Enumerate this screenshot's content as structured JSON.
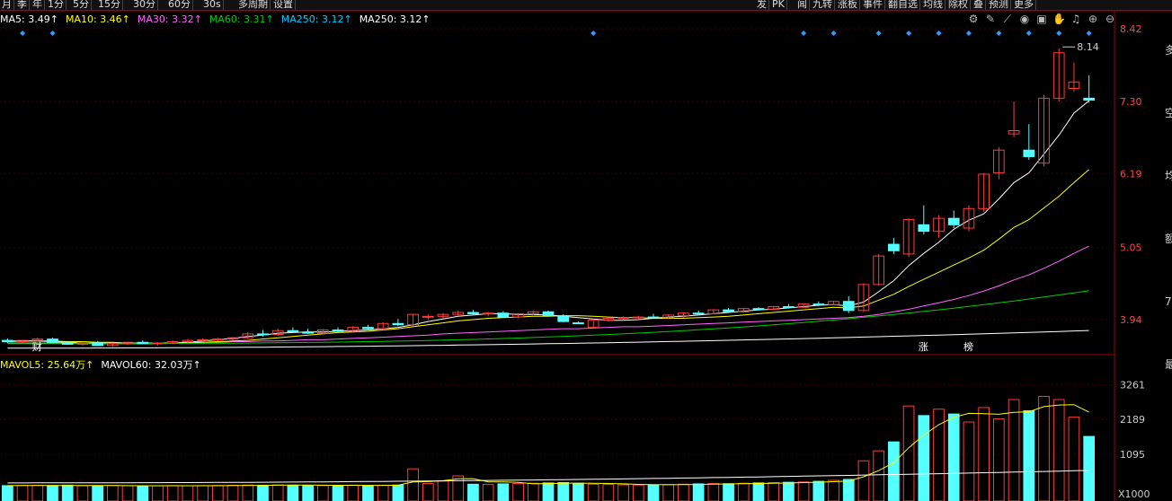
{
  "toolbar": {
    "left_buttons": [
      "月",
      "季",
      "年",
      "1分",
      "5分",
      "15分",
      "30分",
      "60分",
      "30s",
      "多周期",
      "设置"
    ],
    "right_buttons": [
      "发",
      "PK",
      "闻",
      "九转",
      "涨板",
      "事件",
      "翻自选",
      "均线",
      "除权",
      "叠",
      "预测",
      "更多"
    ]
  },
  "icons": [
    "gear-icon",
    "pen-icon",
    "ruler-icon",
    "eye-icon",
    "gift-icon",
    "hand-icon",
    "bell-icon",
    "zoom-in-icon",
    "zoom-out-icon"
  ],
  "ma_legend": [
    {
      "label": "MA5: 3.49",
      "color": "#ffffff"
    },
    {
      "label": "MA10: 3.46",
      "color": "#ffff00"
    },
    {
      "label": "MA30: 3.32",
      "color": "#ff66ff"
    },
    {
      "label": "MA60: 3.31",
      "color": "#00cc00"
    },
    {
      "label": "MA250: 3.12",
      "color": "#00ccff"
    },
    {
      "label": "MA250: 3.12",
      "color": "#ffffff"
    }
  ],
  "vol_legend": [
    {
      "label": "MAVOL5: 25.64万",
      "color": "#ffff00"
    },
    {
      "label": "MAVOL60: 32.03万",
      "color": "#ffffff"
    }
  ],
  "price_axis": [
    "8.42",
    "7.30",
    "6.19",
    "5.05",
    "3.94"
  ],
  "volume_axis": [
    "3261",
    "2189",
    "1095"
  ],
  "volume_unit": "X1000",
  "max_price_label": "8.14",
  "markers": [
    {
      "text": "财",
      "color": "#ffffff"
    },
    {
      "text": "涨",
      "color": "#ffffff"
    },
    {
      "text": "榜",
      "color": "#ffffff"
    }
  ],
  "right_edge_chars": [
    "多",
    "空",
    "均",
    "额",
    "7",
    "最"
  ],
  "chart_data": {
    "type": "candlestick",
    "price_range": [
      3.4,
      8.42
    ],
    "volume_range": [
      0,
      3500
    ],
    "candles": [
      [
        3.62,
        3.65,
        3.58,
        3.6
      ],
      [
        3.6,
        3.63,
        3.57,
        3.62
      ],
      [
        3.62,
        3.66,
        3.6,
        3.64
      ],
      [
        3.64,
        3.66,
        3.58,
        3.59
      ],
      [
        3.59,
        3.61,
        3.55,
        3.56
      ],
      [
        3.56,
        3.6,
        3.54,
        3.58
      ],
      [
        3.58,
        3.61,
        3.53,
        3.54
      ],
      [
        3.54,
        3.58,
        3.52,
        3.57
      ],
      [
        3.57,
        3.6,
        3.55,
        3.59
      ],
      [
        3.59,
        3.62,
        3.56,
        3.57
      ],
      [
        3.57,
        3.59,
        3.54,
        3.58
      ],
      [
        3.58,
        3.62,
        3.56,
        3.6
      ],
      [
        3.6,
        3.64,
        3.58,
        3.62
      ],
      [
        3.62,
        3.65,
        3.6,
        3.63
      ],
      [
        3.63,
        3.66,
        3.61,
        3.64
      ],
      [
        3.64,
        3.67,
        3.62,
        3.66
      ],
      [
        3.66,
        3.75,
        3.64,
        3.72
      ],
      [
        3.72,
        3.78,
        3.68,
        3.71
      ],
      [
        3.71,
        3.8,
        3.69,
        3.77
      ],
      [
        3.77,
        3.82,
        3.74,
        3.75
      ],
      [
        3.75,
        3.8,
        3.72,
        3.73
      ],
      [
        3.73,
        3.79,
        3.71,
        3.78
      ],
      [
        3.78,
        3.82,
        3.74,
        3.76
      ],
      [
        3.76,
        3.84,
        3.74,
        3.82
      ],
      [
        3.82,
        3.86,
        3.78,
        3.8
      ],
      [
        3.8,
        3.9,
        3.78,
        3.88
      ],
      [
        3.88,
        3.95,
        3.84,
        3.86
      ],
      [
        3.86,
        4.03,
        3.84,
        4.02
      ],
      [
        3.98,
        4.02,
        3.94,
        3.99
      ],
      [
        3.99,
        4.04,
        3.96,
        4.02
      ],
      [
        4.02,
        4.08,
        3.99,
        4.05
      ],
      [
        4.05,
        4.09,
        4.01,
        4.03
      ],
      [
        4.03,
        4.06,
        3.99,
        4.04
      ],
      [
        4.04,
        4.07,
        3.97,
        3.98
      ],
      [
        3.98,
        4.04,
        3.96,
        4.03
      ],
      [
        4.03,
        4.08,
        4.01,
        4.06
      ],
      [
        4.06,
        4.08,
        3.99,
        4.0
      ],
      [
        4.0,
        4.02,
        3.9,
        3.91
      ],
      [
        3.89,
        3.91,
        3.87,
        3.88
      ],
      [
        3.82,
        3.95,
        3.81,
        3.93
      ],
      [
        3.93,
        3.97,
        3.91,
        3.96
      ],
      [
        3.96,
        3.99,
        3.93,
        3.97
      ],
      [
        3.97,
        4.0,
        3.94,
        3.98
      ],
      [
        3.98,
        4.03,
        3.96,
        3.97
      ],
      [
        3.97,
        4.02,
        3.95,
        4.01
      ],
      [
        4.0,
        4.05,
        3.97,
        4.04
      ],
      [
        4.04,
        4.08,
        4.01,
        4.03
      ],
      [
        4.03,
        4.1,
        4.02,
        4.09
      ],
      [
        4.09,
        4.12,
        4.05,
        4.06
      ],
      [
        4.06,
        4.12,
        4.05,
        4.11
      ],
      [
        4.11,
        4.13,
        4.08,
        4.1
      ],
      [
        4.1,
        4.15,
        4.09,
        4.14
      ],
      [
        4.14,
        4.18,
        4.11,
        4.13
      ],
      [
        4.13,
        4.19,
        4.12,
        4.18
      ],
      [
        4.18,
        4.22,
        4.15,
        4.17
      ],
      [
        4.17,
        4.23,
        4.16,
        4.22
      ],
      [
        4.22,
        4.3,
        4.04,
        4.08
      ],
      [
        4.08,
        4.5,
        4.06,
        4.48
      ],
      [
        4.48,
        4.95,
        4.46,
        4.92
      ],
      [
        5.1,
        5.2,
        4.95,
        5.0
      ],
      [
        4.95,
        5.5,
        4.9,
        5.48
      ],
      [
        5.4,
        5.7,
        5.25,
        5.3
      ],
      [
        5.3,
        5.55,
        5.2,
        5.5
      ],
      [
        5.5,
        5.62,
        5.35,
        5.4
      ],
      [
        5.35,
        5.7,
        5.3,
        5.65
      ],
      [
        5.65,
        6.2,
        5.6,
        6.18
      ],
      [
        6.2,
        6.6,
        6.1,
        6.55
      ],
      [
        6.8,
        7.3,
        6.75,
        6.85
      ],
      [
        6.55,
        6.95,
        6.4,
        6.45
      ],
      [
        6.35,
        7.4,
        6.3,
        7.35
      ],
      [
        7.35,
        8.12,
        7.3,
        8.05
      ],
      [
        7.5,
        7.9,
        7.45,
        7.6
      ],
      [
        7.35,
        7.7,
        7.28,
        7.32
      ]
    ],
    "volumes": [
      115,
      120,
      125,
      118,
      130,
      110,
      105,
      120,
      112,
      108,
      110,
      116,
      112,
      115,
      118,
      125,
      135,
      128,
      140,
      130,
      122,
      118,
      125,
      130,
      120,
      128,
      135,
      640,
      180,
      260,
      420,
      160,
      150,
      170,
      180,
      190,
      200,
      210,
      190,
      160,
      150,
      140,
      135,
      140,
      150,
      160,
      170,
      180,
      175,
      190,
      200,
      210,
      220,
      230,
      250,
      280,
      310,
      890,
      1200,
      1480,
      2600,
      2300,
      2500,
      2350,
      2100,
      2550,
      2200,
      2800,
      2450,
      2900,
      2800,
      2250,
      1650
    ],
    "dots_price": [
      1,
      3,
      39,
      53,
      55,
      58,
      60,
      62,
      64,
      66,
      68,
      70,
      72
    ],
    "ma5": [
      3.6,
      3.61,
      3.61,
      3.6,
      3.59,
      3.58,
      3.57,
      3.57,
      3.57,
      3.57,
      3.57,
      3.58,
      3.59,
      3.61,
      3.63,
      3.65,
      3.68,
      3.7,
      3.73,
      3.74,
      3.75,
      3.75,
      3.76,
      3.77,
      3.78,
      3.8,
      3.82,
      3.86,
      3.91,
      3.95,
      3.99,
      4.01,
      4.03,
      4.03,
      4.02,
      4.02,
      4.01,
      3.99,
      3.97,
      3.95,
      3.93,
      3.93,
      3.94,
      3.96,
      3.98,
      3.99,
      4.01,
      4.03,
      4.05,
      4.07,
      4.09,
      4.1,
      4.12,
      4.14,
      4.16,
      4.17,
      4.15,
      4.21,
      4.37,
      4.54,
      4.77,
      4.96,
      5.13,
      5.33,
      5.47,
      5.57,
      5.8,
      6.05,
      6.2,
      6.49,
      6.78,
      7.12,
      7.31
    ],
    "ma10": [
      3.61,
      3.61,
      3.61,
      3.61,
      3.6,
      3.6,
      3.59,
      3.59,
      3.58,
      3.58,
      3.58,
      3.58,
      3.58,
      3.59,
      3.6,
      3.61,
      3.62,
      3.64,
      3.66,
      3.68,
      3.7,
      3.72,
      3.74,
      3.75,
      3.76,
      3.78,
      3.8,
      3.83,
      3.86,
      3.89,
      3.92,
      3.94,
      3.96,
      3.97,
      3.98,
      3.99,
      3.99,
      4.0,
      4.0,
      3.99,
      3.98,
      3.97,
      3.97,
      3.96,
      3.96,
      3.96,
      3.97,
      3.98,
      3.99,
      4.01,
      4.03,
      4.05,
      4.07,
      4.09,
      4.11,
      4.13,
      4.12,
      4.15,
      4.24,
      4.33,
      4.45,
      4.56,
      4.67,
      4.78,
      4.89,
      5.01,
      5.18,
      5.36,
      5.48,
      5.66,
      5.84,
      6.05,
      6.25
    ],
    "ma30": [
      3.58,
      3.58,
      3.58,
      3.58,
      3.58,
      3.58,
      3.58,
      3.58,
      3.58,
      3.58,
      3.58,
      3.58,
      3.58,
      3.59,
      3.59,
      3.6,
      3.6,
      3.61,
      3.61,
      3.62,
      3.63,
      3.63,
      3.64,
      3.65,
      3.66,
      3.67,
      3.68,
      3.69,
      3.7,
      3.72,
      3.73,
      3.74,
      3.75,
      3.76,
      3.77,
      3.78,
      3.79,
      3.8,
      3.8,
      3.81,
      3.82,
      3.83,
      3.83,
      3.84,
      3.85,
      3.86,
      3.87,
      3.88,
      3.89,
      3.9,
      3.91,
      3.92,
      3.93,
      3.94,
      3.95,
      3.96,
      3.97,
      3.99,
      4.02,
      4.06,
      4.1,
      4.15,
      4.2,
      4.25,
      4.31,
      4.38,
      4.46,
      4.55,
      4.63,
      4.73,
      4.84,
      4.96,
      5.07
    ]
  }
}
